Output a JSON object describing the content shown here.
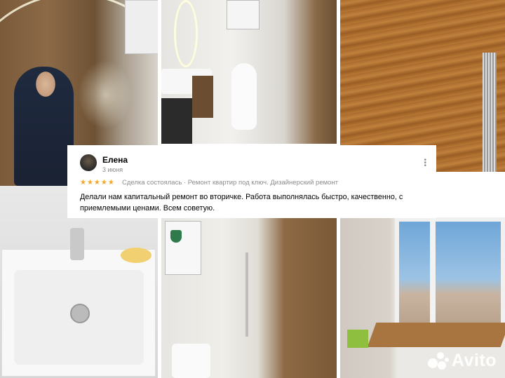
{
  "review": {
    "author": "Елена",
    "date": "3 июня",
    "rating_stars": "★★★★★",
    "rating": 5,
    "deal_text": "Сделка состоялась · Ремонт квартир под ключ. Дизайнерский ремонт",
    "body": "Делали нам капитальный ремонт во вторичке. Работа выполнялась быстро, качественно, с приемлемыми ценами. Всем советую."
  },
  "watermark": {
    "text": "Avito"
  },
  "colors": {
    "star": "#f5a623",
    "muted": "#8c8c8c"
  }
}
